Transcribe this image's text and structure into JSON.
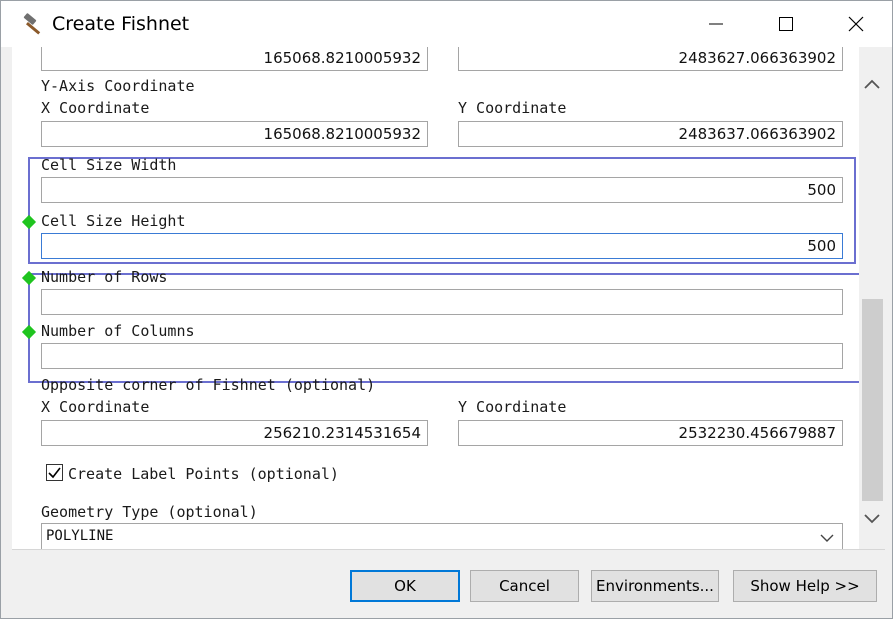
{
  "window": {
    "title": "Create Fishnet"
  },
  "top_fields": {
    "x_value": "165068.8210005932",
    "y_value": "2483627.066363902"
  },
  "y_axis": {
    "heading": "Y-Axis Coordinate",
    "x_label": "X Coordinate",
    "x_value": "165068.8210005932",
    "y_label": "Y Coordinate",
    "y_value": "2483637.066363902"
  },
  "cell_size": {
    "width_label": "Cell Size Width",
    "width_value": "500",
    "height_label": "Cell Size Height",
    "height_value": "500"
  },
  "counts": {
    "rows_label": "Number of Rows",
    "rows_value": "",
    "columns_label": "Number of Columns",
    "columns_value": ""
  },
  "opposite_corner": {
    "heading": "Opposite corner of Fishnet (optional)",
    "x_label": "X Coordinate",
    "x_value": "256210.2314531654",
    "y_label": "Y Coordinate",
    "y_value": "2532230.456679887"
  },
  "label_points": {
    "label": "Create Label Points (optional)",
    "checked": true
  },
  "geometry": {
    "label": "Geometry Type (optional)",
    "value": "POLYLINE"
  },
  "buttons": {
    "ok": "OK",
    "cancel": "Cancel",
    "environments": "Environments...",
    "show_help": "Show Help >>"
  },
  "colors": {
    "highlight_box": "#6b6fd0",
    "required_dot": "#1fc41f",
    "focus_border": "#3a7bd5",
    "ok_border": "#0078d7"
  },
  "icons": {
    "app": "hammer-icon",
    "minimize": "minimize-icon",
    "maximize": "maximize-icon",
    "close": "close-icon"
  }
}
